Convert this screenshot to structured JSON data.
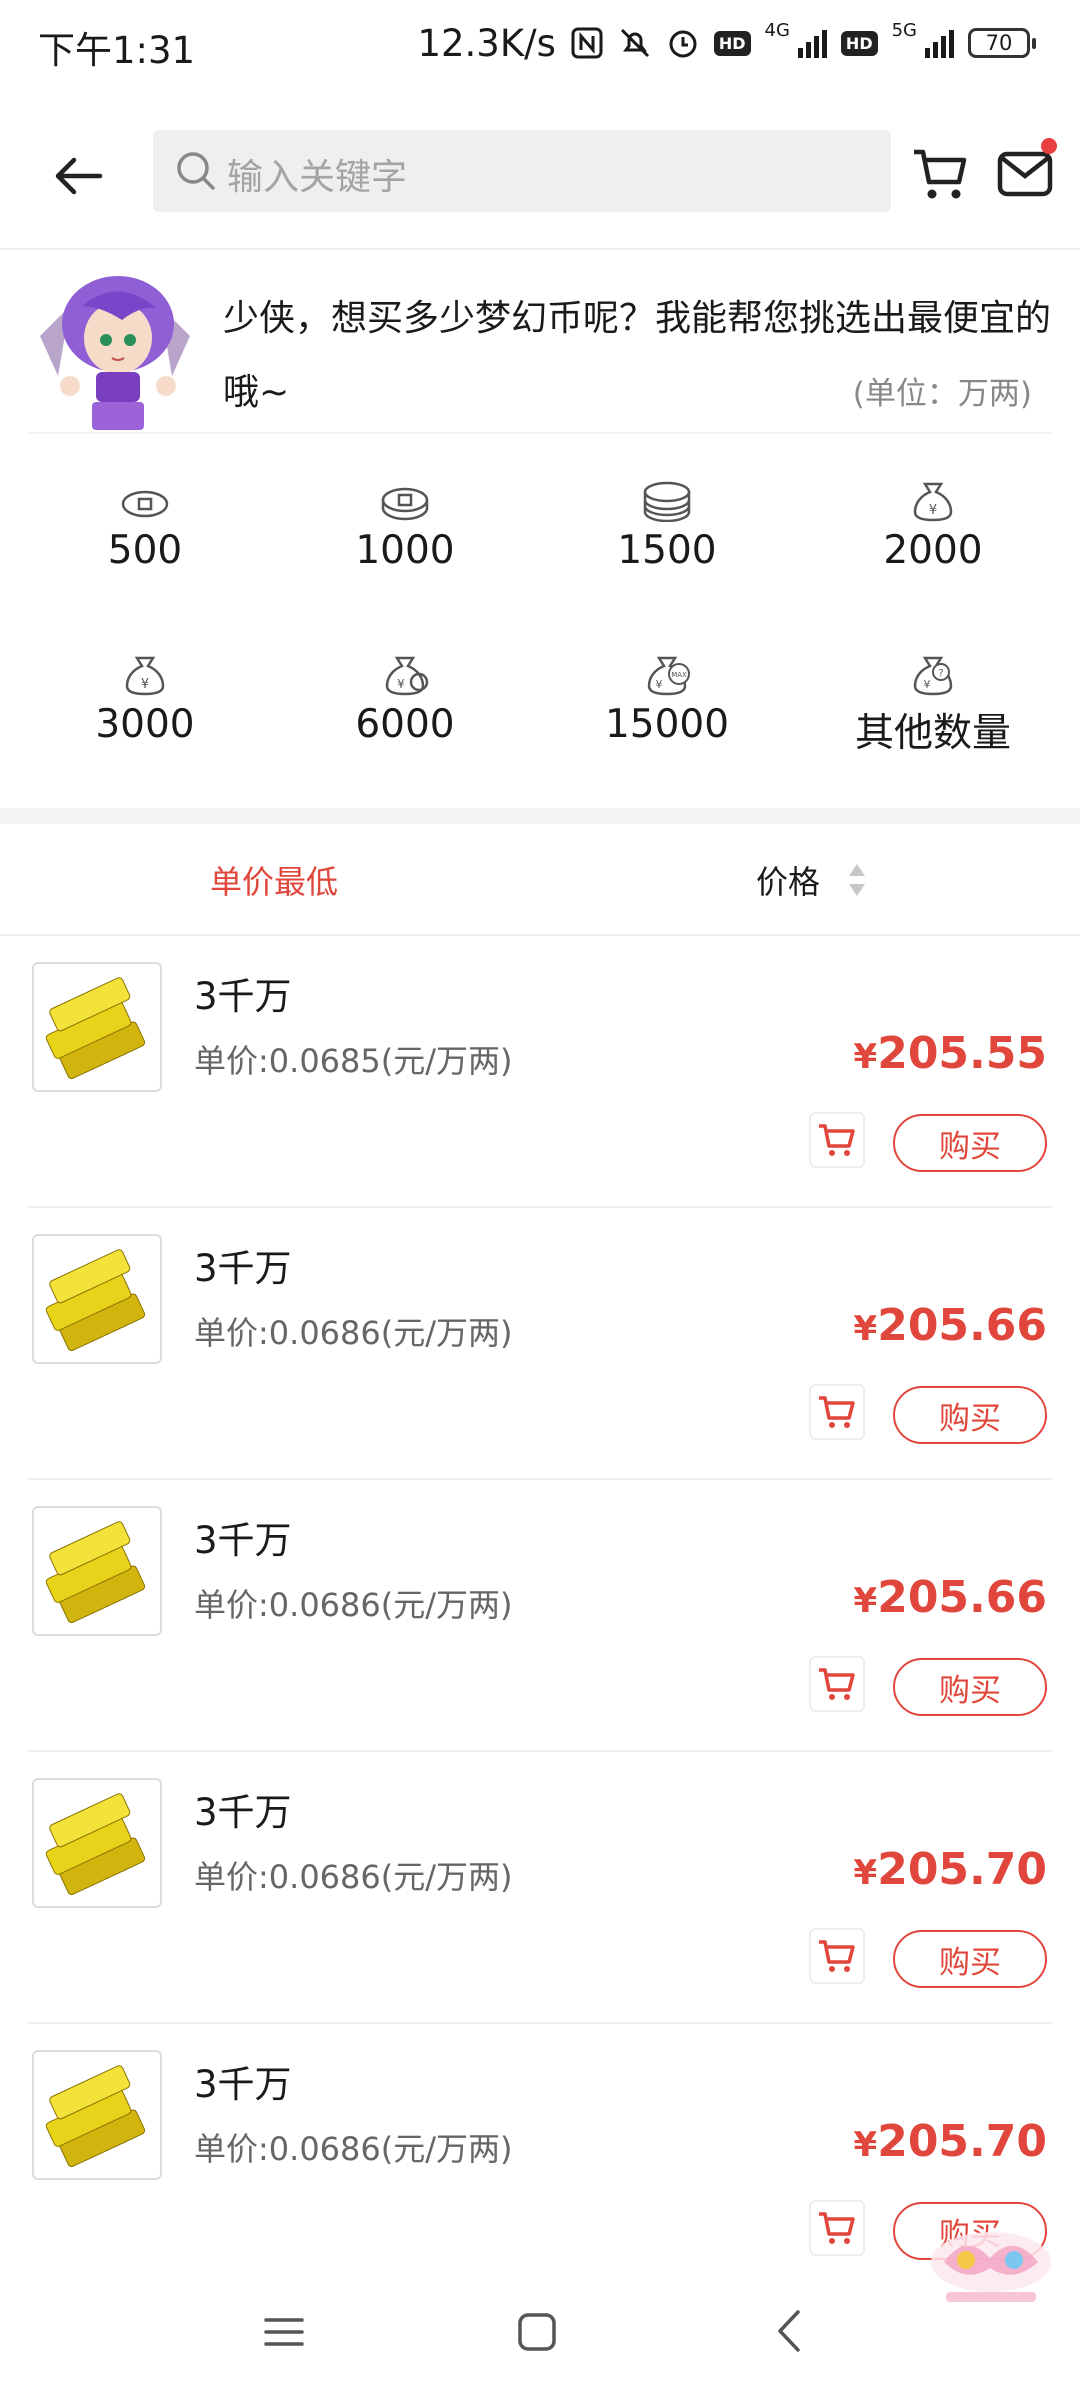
{
  "status_bar": {
    "time": "下午1:31",
    "net_speed": "12.3K/s",
    "net_4g": "4G",
    "net_5g": "5G",
    "hd": "HD",
    "battery": "70"
  },
  "header": {
    "search_placeholder": "输入关键字"
  },
  "hint": {
    "message": "少侠，想买多少梦幻币呢？我能帮您挑选出最便宜的哦~",
    "unit": "(单位：万两)"
  },
  "amounts": [
    {
      "label": "500",
      "icon": "coin-small-icon"
    },
    {
      "label": "1000",
      "icon": "coin-stack-icon"
    },
    {
      "label": "1500",
      "icon": "coin-stack-large-icon"
    },
    {
      "label": "2000",
      "icon": "money-bag-icon"
    },
    {
      "label": "3000",
      "icon": "money-bag-icon"
    },
    {
      "label": "6000",
      "icon": "money-bag-large-icon"
    },
    {
      "label": "15000",
      "icon": "money-bag-max-icon"
    },
    {
      "label": "其他数量",
      "icon": "money-bag-question-icon"
    }
  ],
  "sort": {
    "lowest_unit_price": "单价最低",
    "price": "价格"
  },
  "products": [
    {
      "title": "3千万",
      "unit_price": "单价:0.0685(元/万两)",
      "currency": "¥",
      "price": "205.55",
      "buy": "购买"
    },
    {
      "title": "3千万",
      "unit_price": "单价:0.0686(元/万两)",
      "currency": "¥",
      "price": "205.66",
      "buy": "购买"
    },
    {
      "title": "3千万",
      "unit_price": "单价:0.0686(元/万两)",
      "currency": "¥",
      "price": "205.66",
      "buy": "购买"
    },
    {
      "title": "3千万",
      "unit_price": "单价:0.0686(元/万两)",
      "currency": "¥",
      "price": "205.70",
      "buy": "购买"
    },
    {
      "title": "3千万",
      "unit_price": "单价:0.0686(元/万两)",
      "currency": "¥",
      "price": "205.70",
      "buy": "购买"
    }
  ],
  "colors": {
    "accent": "#e0463b",
    "gold": "#e8d21a"
  }
}
